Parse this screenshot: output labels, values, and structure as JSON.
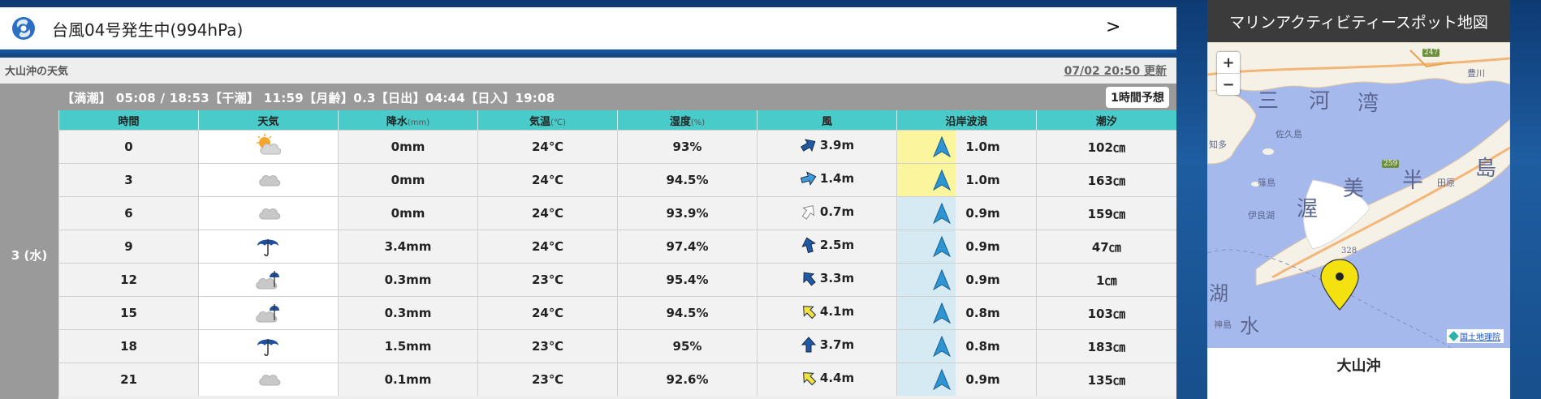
{
  "typhoon": {
    "text": "台風04号発生中(994hPa)",
    "arrow": ">"
  },
  "weather": {
    "title": "大山沖の天気",
    "updated": "07/02 20:50 更新",
    "tide_info": "【満潮】 05:08 / 18:53【干潮】 11:59【月齢】0.3【日出】04:44【日入】19:08",
    "hourly_button": "1時間予想",
    "day_label": "3 (水)",
    "headers": [
      {
        "label": "時間",
        "unit": ""
      },
      {
        "label": "天気",
        "unit": ""
      },
      {
        "label": "降水",
        "unit": "(mm)"
      },
      {
        "label": "気温",
        "unit": "(℃)"
      },
      {
        "label": "湿度",
        "unit": "(%)"
      },
      {
        "label": "風",
        "unit": ""
      },
      {
        "label": "沿岸波浪",
        "unit": ""
      },
      {
        "label": "潮汐",
        "unit": ""
      }
    ],
    "rows": [
      {
        "time": "0",
        "weather_icon": "partly-cloudy-icon",
        "precip": "0mm",
        "temp": "24℃",
        "humidity": "93%",
        "wind_icon": "arrow-east-icon",
        "wind_rotation_deg": 60,
        "wind_color": "#1f5aa6",
        "wind": "3.9m",
        "wave_highlight": "#fbf59d",
        "wave": "1.0m",
        "tide": "102㎝"
      },
      {
        "time": "3",
        "weather_icon": "cloud-icon",
        "precip": "0mm",
        "temp": "24℃",
        "humidity": "94.5%",
        "wind_icon": "arrow-east-icon",
        "wind_rotation_deg": 75,
        "wind_color": "#3d9bd9",
        "wind": "1.4m",
        "wave_highlight": "#fbf59d",
        "wave": "1.0m",
        "tide": "163㎝"
      },
      {
        "time": "6",
        "weather_icon": "cloud-icon",
        "precip": "0mm",
        "temp": "24℃",
        "humidity": "93.9%",
        "wind_icon": "arrow-northeast-icon",
        "wind_rotation_deg": 35,
        "wind_color": "#ffffff",
        "wind": "0.7m",
        "wave_highlight": "#d6eaf4",
        "wave": "0.9m",
        "tide": "159㎝"
      },
      {
        "time": "9",
        "weather_icon": "umbrella-icon",
        "precip": "3.4mm",
        "temp": "24℃",
        "humidity": "97.4%",
        "wind_icon": "arrow-north-icon",
        "wind_rotation_deg": -15,
        "wind_color": "#1f5aa6",
        "wind": "2.5m",
        "wave_highlight": "#d6eaf4",
        "wave": "0.9m",
        "tide": "47㎝"
      },
      {
        "time": "12",
        "weather_icon": "cloud-umbrella-icon",
        "precip": "0.3mm",
        "temp": "23℃",
        "humidity": "95.4%",
        "wind_icon": "arrow-northwest-icon",
        "wind_rotation_deg": -40,
        "wind_color": "#1f5aa6",
        "wind": "3.3m",
        "wave_highlight": "#d6eaf4",
        "wave": "0.9m",
        "tide": "1㎝"
      },
      {
        "time": "15",
        "weather_icon": "cloud-umbrella-icon",
        "precip": "0.3mm",
        "temp": "24℃",
        "humidity": "94.5%",
        "wind_icon": "arrow-northwest-icon",
        "wind_rotation_deg": -45,
        "wind_color": "#f2e240",
        "wind": "4.1m",
        "wave_highlight": "#d6eaf4",
        "wave": "0.8m",
        "tide": "103㎝"
      },
      {
        "time": "18",
        "weather_icon": "umbrella-icon",
        "precip": "1.5mm",
        "temp": "23℃",
        "humidity": "95%",
        "wind_icon": "arrow-north-icon",
        "wind_rotation_deg": 0,
        "wind_color": "#1f5aa6",
        "wind": "3.7m",
        "wave_highlight": "#d6eaf4",
        "wave": "0.8m",
        "tide": "183㎝"
      },
      {
        "time": "21",
        "weather_icon": "cloud-icon",
        "precip": "0.1mm",
        "temp": "23℃",
        "humidity": "92.6%",
        "wind_icon": "arrow-northwest-icon",
        "wind_rotation_deg": -45,
        "wind_color": "#f2e240",
        "wind": "4.4m",
        "wave_highlight": "#d6eaf4",
        "wave": "0.9m",
        "tide": "135㎝"
      }
    ]
  },
  "map": {
    "title": "マリンアクティビティースポット地図",
    "zoom_in": "+",
    "zoom_out": "−",
    "labels": {
      "bay_1": "三",
      "bay_2": "河",
      "bay_3": "湾",
      "pen_1": "渥",
      "pen_2": "美",
      "pen_3": "半",
      "pen_4": "島",
      "sakushima": "佐久島",
      "chita": "知多",
      "himakajima": "篠島",
      "tahara": "田原",
      "irago": "伊良湖",
      "toyokawa": "豊川",
      "road": "247",
      "route": "259",
      "elev": "328",
      "lake_1": "湖",
      "lake_2": "水",
      "kami": "神島"
    },
    "credit": "国土地理院",
    "spot": "大山沖"
  }
}
